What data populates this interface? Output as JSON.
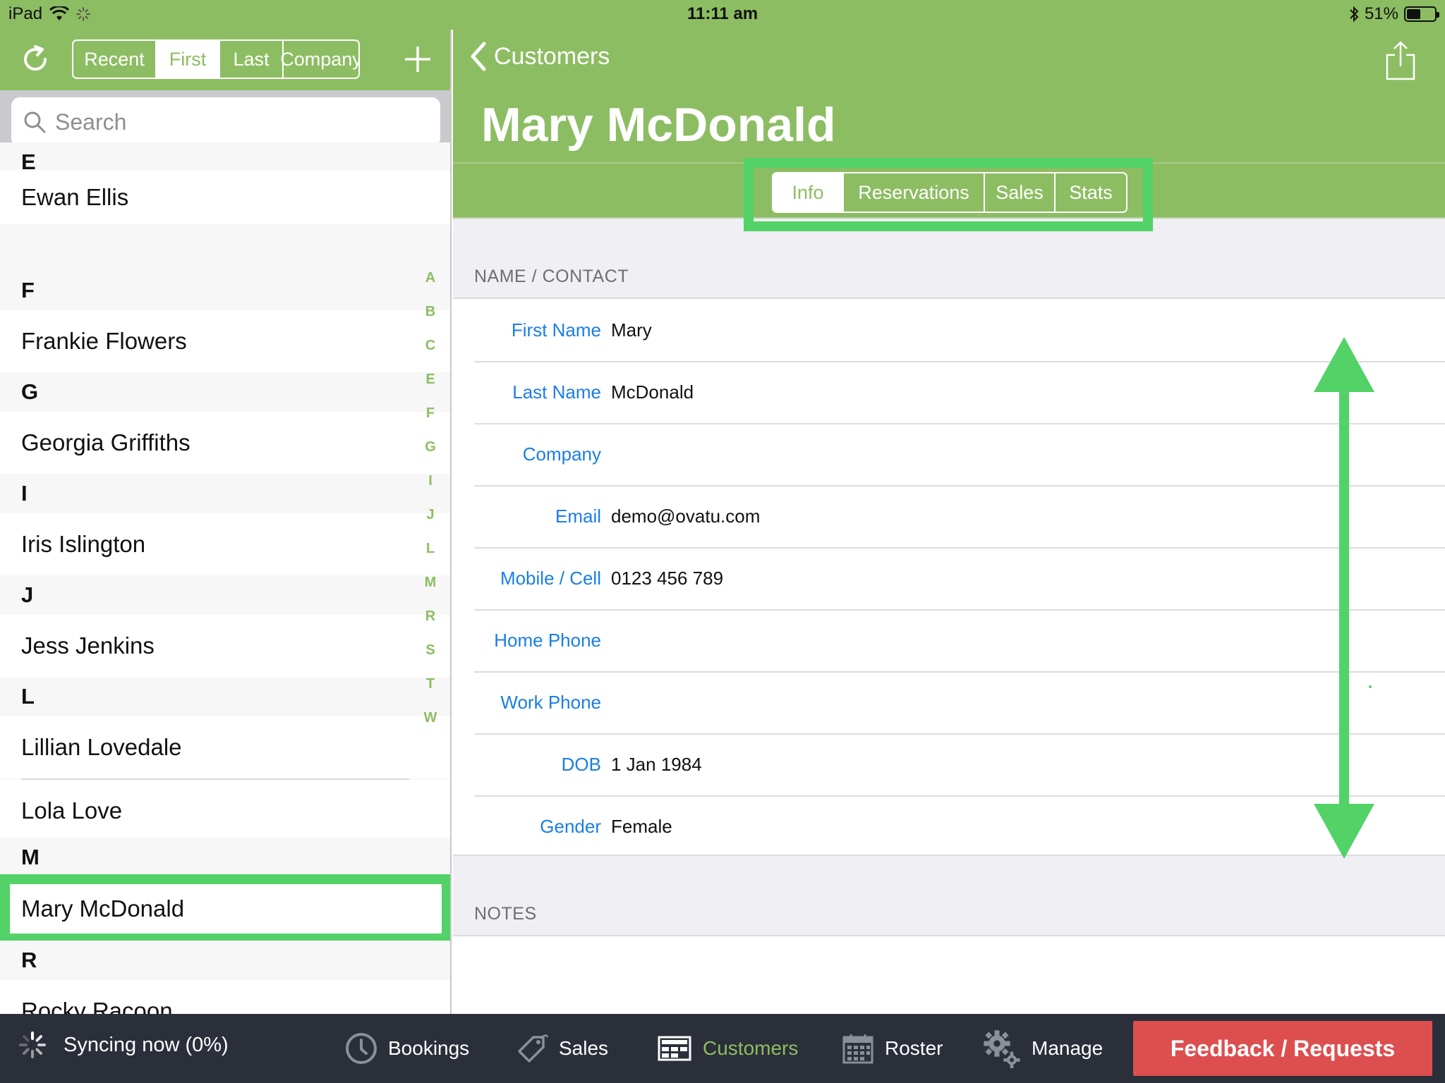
{
  "status_bar": {
    "device": "iPad",
    "time": "11:11 am",
    "battery_percent": "51%",
    "battery_level": 0.51
  },
  "left_pane": {
    "sort_tabs": [
      {
        "label": "Recent",
        "active": false
      },
      {
        "label": "First",
        "active": true
      },
      {
        "label": "Last",
        "active": false
      },
      {
        "label": "Company",
        "active": false
      }
    ],
    "search_placeholder": "Search",
    "sections": [
      {
        "letter": "E",
        "items": [
          "Ewan Ellis"
        ]
      },
      {
        "letter": "F",
        "items": [
          "Frankie Flowers"
        ]
      },
      {
        "letter": "G",
        "items": [
          "Georgia Griffiths"
        ]
      },
      {
        "letter": "I",
        "items": [
          "Iris Islington"
        ]
      },
      {
        "letter": "J",
        "items": [
          "Jess Jenkins"
        ]
      },
      {
        "letter": "L",
        "items": [
          "Lillian Lovedale",
          "Lola Love"
        ]
      },
      {
        "letter": "M",
        "items": [
          "Mary McDonald"
        ]
      },
      {
        "letter": "R",
        "items": [
          "Rocky Racoon"
        ]
      }
    ],
    "selected_item": "Mary McDonald",
    "index_letters": [
      "A",
      "B",
      "C",
      "E",
      "F",
      "G",
      "I",
      "J",
      "L",
      "M",
      "R",
      "S",
      "T",
      "W"
    ]
  },
  "detail": {
    "back_label": "Customers",
    "title": "Mary McDonald",
    "tabs": [
      {
        "label": "Info",
        "active": true
      },
      {
        "label": "Reservations",
        "active": false
      },
      {
        "label": "Sales",
        "active": false
      },
      {
        "label": "Stats",
        "active": false
      }
    ],
    "section_contact": "NAME / CONTACT",
    "fields": [
      {
        "label": "First Name",
        "value": "Mary"
      },
      {
        "label": "Last Name",
        "value": "McDonald"
      },
      {
        "label": "Company",
        "value": ""
      },
      {
        "label": "Email",
        "value": "demo@ovatu.com"
      },
      {
        "label": "Mobile / Cell",
        "value": "0123 456 789"
      },
      {
        "label": "Home Phone",
        "value": ""
      },
      {
        "label": "Work Phone",
        "value": ""
      },
      {
        "label": "DOB",
        "value": "1 Jan 1984"
      },
      {
        "label": "Gender",
        "value": "Female"
      }
    ],
    "section_notes": "NOTES"
  },
  "tab_bar": {
    "sync_status": "Syncing now (0%)",
    "tabs": [
      {
        "label": "Bookings",
        "icon": "clock-icon",
        "active": false
      },
      {
        "label": "Sales",
        "icon": "price-tag-icon",
        "active": false
      },
      {
        "label": "Customers",
        "icon": "customers-icon",
        "active": true
      },
      {
        "label": "Roster",
        "icon": "calendar-icon",
        "active": false
      },
      {
        "label": "Manage",
        "icon": "gears-icon",
        "active": false
      }
    ],
    "feedback_label": "Feedback / Requests"
  },
  "colors": {
    "brand_green": "#8dbd62",
    "highlight_green": "#52d267",
    "link_blue": "#1a7ee6",
    "tabbar_bg": "#2a2f3a",
    "feedback_red": "#dd4f4f"
  }
}
